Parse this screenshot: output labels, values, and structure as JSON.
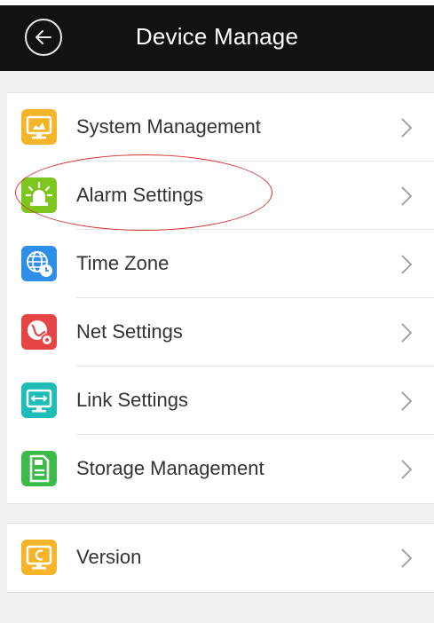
{
  "header": {
    "title": "Device Manage",
    "back_icon": "back-arrow-icon"
  },
  "menu_sections": [
    {
      "items": [
        {
          "label": "System Management",
          "icon": "monitor-settings-icon",
          "color": "#f5b52a"
        },
        {
          "label": "Alarm Settings",
          "icon": "alarm-light-icon",
          "color": "#7cc61f"
        },
        {
          "label": "Time Zone",
          "icon": "globe-clock-icon",
          "color": "#2f8ee8"
        },
        {
          "label": "Net Settings",
          "icon": "network-gear-icon",
          "color": "#e64545"
        },
        {
          "label": "Link Settings",
          "icon": "link-monitor-icon",
          "color": "#1fbcb8"
        },
        {
          "label": "Storage Management",
          "icon": "sd-card-icon",
          "color": "#3dbb4a"
        }
      ]
    },
    {
      "items": [
        {
          "label": "Version",
          "icon": "version-monitor-icon",
          "color": "#f5b52a"
        }
      ]
    }
  ],
  "annotation": {
    "highlight_color": "#d9302d"
  }
}
